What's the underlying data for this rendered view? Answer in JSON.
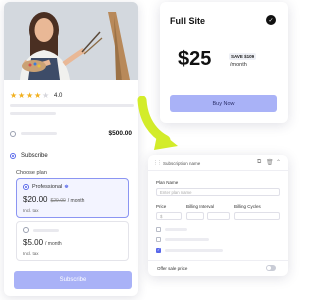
{
  "product": {
    "rating": "4.0",
    "stars_filled": 4,
    "stars_total": 5,
    "one_time_price": "$500.00",
    "subscribe_label": "Subscribe",
    "choose_plan_label": "Choose plan",
    "plans": [
      {
        "name": "Professional",
        "price": "$20.00",
        "old_price": "$29.00",
        "per": "/ month",
        "tax": "Incl. tax"
      },
      {
        "name": "",
        "price": "$5.00",
        "old_price": "",
        "per": "/ month",
        "tax": "Incl. tax"
      }
    ],
    "subscribe_button": "Subscribe"
  },
  "site_plan": {
    "title": "Full Site",
    "price": "$25",
    "save_badge": "SAVE $109",
    "per": "/month",
    "buy_button": "Buy Now"
  },
  "subscription_form": {
    "header": "Subscription name",
    "plan_name_label": "Plan Name",
    "plan_name_placeholder": "Enter plan name",
    "price_label": "Price",
    "price_value": "$",
    "billing_interval_label": "Billing Interval",
    "billing_interval_value": "",
    "billing_cycles_label": "Billing Cycles",
    "offer_sale_price_label": "Offer sale price"
  },
  "colors": {
    "accent": "#5867ea",
    "button": "#a9b2f7",
    "star": "#f2b01e",
    "arrow": "#d3ec2a"
  }
}
